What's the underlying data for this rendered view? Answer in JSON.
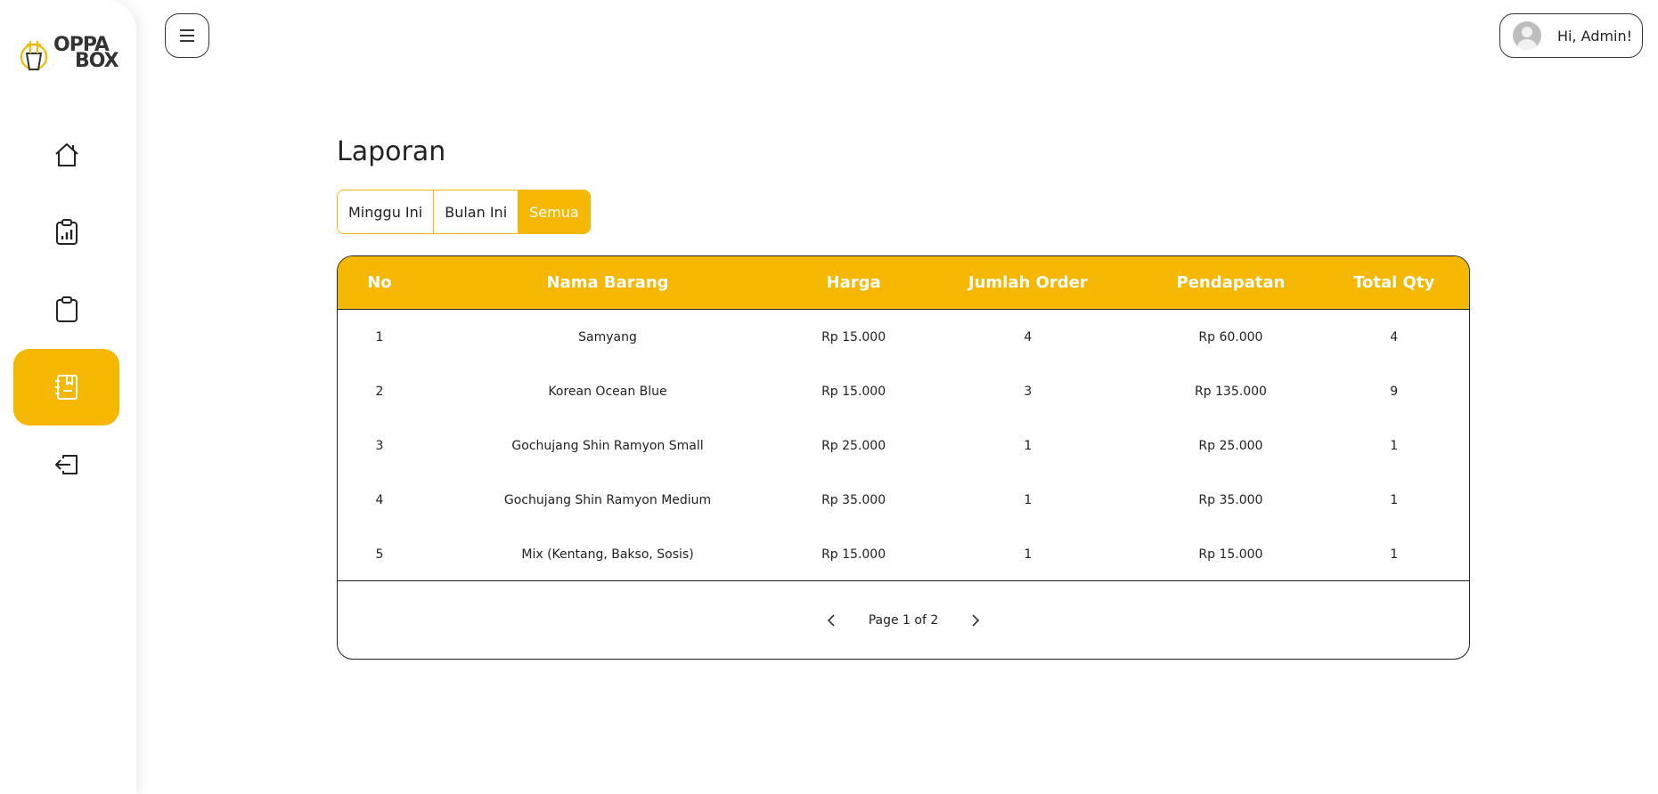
{
  "brand": {
    "line1": "OPPA",
    "line2": "BOX",
    "accent": "#f5b700"
  },
  "sidebar": {
    "items": [
      {
        "name": "home",
        "icon": "home-icon",
        "active": false
      },
      {
        "name": "reports-chart",
        "icon": "clipboard-chart-icon",
        "active": false
      },
      {
        "name": "orders",
        "icon": "clipboard-icon",
        "active": false
      },
      {
        "name": "laporan",
        "icon": "notebook-icon",
        "active": true
      },
      {
        "name": "logout",
        "icon": "logout-icon",
        "active": false
      }
    ]
  },
  "header": {
    "user_greeting": "Hi, Admin!"
  },
  "main": {
    "title": "Laporan",
    "filters": [
      {
        "label": "Minggu Ini",
        "active": false
      },
      {
        "label": "Bulan Ini",
        "active": false
      },
      {
        "label": "Semua",
        "active": true
      }
    ],
    "table": {
      "columns": [
        "No",
        "Nama Barang",
        "Harga",
        "Jumlah Order",
        "Pendapatan",
        "Total Qty"
      ],
      "rows": [
        [
          "1",
          "Samyang",
          "Rp 15.000",
          "4",
          "Rp 60.000",
          "4"
        ],
        [
          "2",
          "Korean Ocean Blue",
          "Rp 15.000",
          "3",
          "Rp 135.000",
          "9"
        ],
        [
          "3",
          "Gochujang Shin Ramyon Small",
          "Rp 25.000",
          "1",
          "Rp 25.000",
          "1"
        ],
        [
          "4",
          "Gochujang Shin Ramyon Medium",
          "Rp 35.000",
          "1",
          "Rp 35.000",
          "1"
        ],
        [
          "5",
          "Mix (Kentang, Bakso, Sosis)",
          "Rp 15.000",
          "1",
          "Rp 15.000",
          "1"
        ]
      ]
    },
    "pagination": {
      "label": "Page 1 of 2",
      "current": 1,
      "total": 2
    }
  }
}
